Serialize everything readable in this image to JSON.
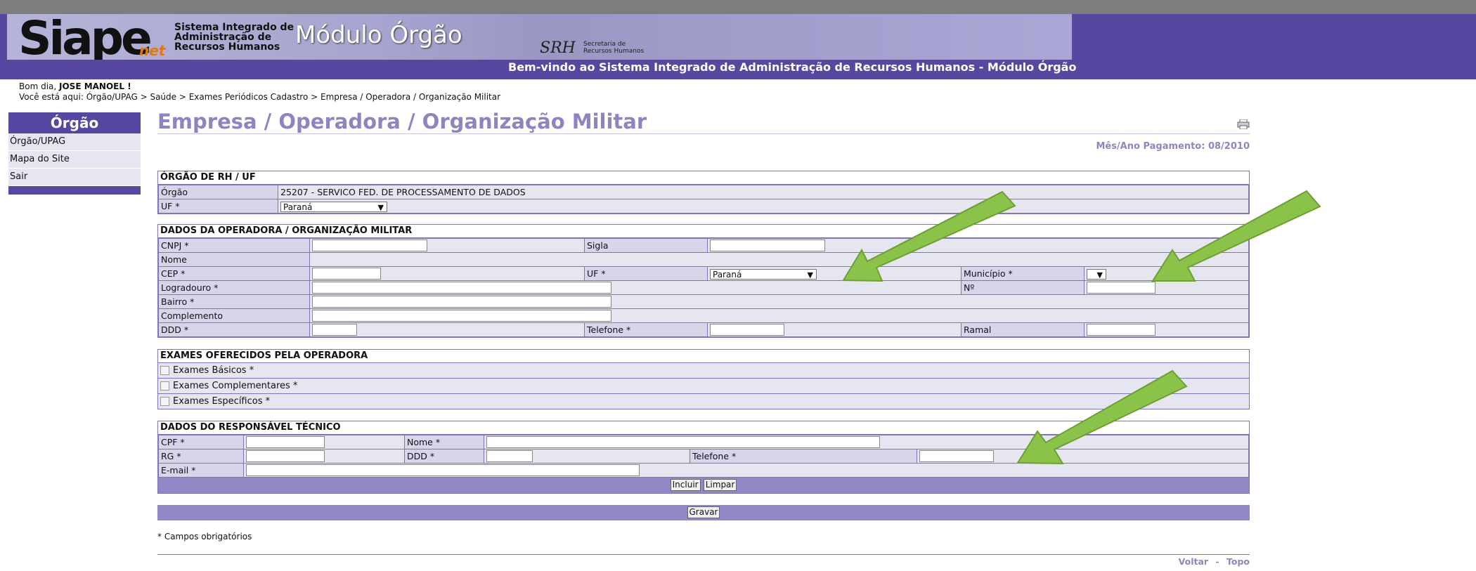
{
  "header": {
    "logo_text": "Siape",
    "logo_net": "net",
    "logo_sub": [
      "Sistema Integrado de",
      "Administração de",
      "Recursos Humanos"
    ],
    "module_title": "Módulo Órgão",
    "srh_logo": "SRH",
    "srh_sub": [
      "Secretaria de",
      "Recursos Humanos"
    ],
    "welcome": "Bem-vindo ao Sistema Integrado de Administração de Recursos Humanos - Módulo Órgão"
  },
  "greeting": {
    "prefix": "Bom dia, ",
    "user": "JOSE MANOEL !",
    "breadcrumb": "Você está aqui:  Órgão/UPAG > Saúde > Exames Periódicos Cadastro > Empresa / Operadora / Organização Militar"
  },
  "sidebar": {
    "title": "Órgão",
    "items": [
      {
        "label": "Órgão/UPAG"
      },
      {
        "label": "Mapa do Site"
      },
      {
        "label": "Sair"
      }
    ]
  },
  "page": {
    "title": "Empresa / Operadora / Organização Militar",
    "pay_period": "Mês/Ano Pagamento: 08/2010",
    "print_icon": "printer-icon"
  },
  "orgao_rh": {
    "title": "ÓRGÃO DE RH / UF",
    "orgao_label": "Órgão",
    "orgao_value": "25207 - SERVICO FED. DE PROCESSAMENTO DE DADOS",
    "uf_label": "UF *",
    "uf_value": "Paraná"
  },
  "operadora": {
    "title": "DADOS DA OPERADORA / ORGANIZAÇÃO MILITAR",
    "cnpj_label": "CNPJ *",
    "sigla_label": "Sigla",
    "nome_label": "Nome",
    "cep_label": "CEP *",
    "uf_label": "UF *",
    "uf_value": "Paraná",
    "municipio_label": "Município *",
    "logradouro_label": "Logradouro *",
    "numero_label": "Nº",
    "bairro_label": "Bairro *",
    "complemento_label": "Complemento",
    "ddd_label": "DDD *",
    "telefone_label": "Telefone *",
    "ramal_label": "Ramal"
  },
  "exames": {
    "title": "EXAMES OFERECIDOS PELA OPERADORA",
    "items": [
      {
        "label": "Exames Básicos *"
      },
      {
        "label": "Exames Complementares *"
      },
      {
        "label": "Exames Específicos *"
      }
    ]
  },
  "responsavel": {
    "title": "DADOS DO RESPONSÁVEL TÉCNICO",
    "cpf_label": "CPF *",
    "nome_label": "Nome *",
    "rg_label": "RG *",
    "ddd_label": "DDD *",
    "telefone_label": "Telefone *",
    "email_label": "E-mail *",
    "incluir_label": "Incluir",
    "limpar_label": "Limpar"
  },
  "actions": {
    "gravar_label": "Gravar"
  },
  "footer": {
    "required_note": "* Campos obrigatórios",
    "voltar": "Voltar",
    "separator": "-",
    "topo": "Topo"
  },
  "colors": {
    "header_bg": "#5647a0",
    "accent": "#8c86c0",
    "arrow": "#8bc34a"
  }
}
